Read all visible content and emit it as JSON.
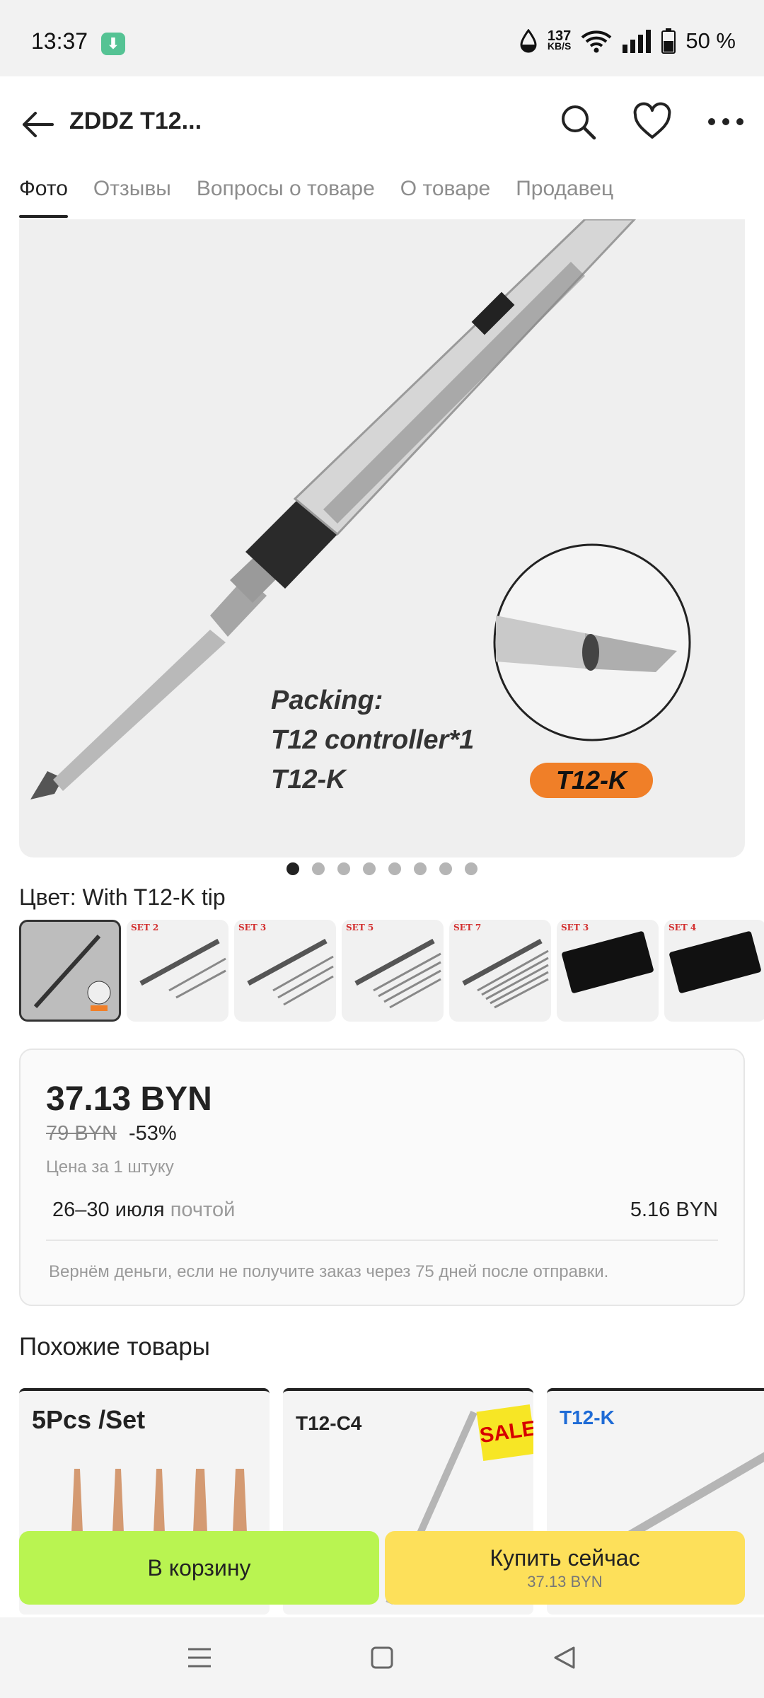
{
  "status_bar": {
    "time": "13:37",
    "speed_value": "137",
    "speed_unit": "KB/S",
    "battery": "50 %"
  },
  "header": {
    "title": "ZDDZ T12..."
  },
  "tabs": [
    {
      "label": "Фото",
      "active": true
    },
    {
      "label": "Отзывы",
      "active": false
    },
    {
      "label": "Вопросы о товаре",
      "active": false
    },
    {
      "label": "О товаре",
      "active": false
    },
    {
      "label": "Продавец",
      "active": false
    }
  ],
  "main_image": {
    "packing_lines": [
      "Packing:",
      "T12 controller*1",
      "T12-K"
    ],
    "tip_badge": "T12-K",
    "accent_color": "#f07f28"
  },
  "carousel": {
    "total": 8,
    "active_index": 0
  },
  "color_option": {
    "label": "Цвет: With T12-K tip"
  },
  "thumbnails": [
    {
      "set": ""
    },
    {
      "set": "SET 2"
    },
    {
      "set": "SET 3"
    },
    {
      "set": "SET 5"
    },
    {
      "set": "SET 7"
    },
    {
      "set": "SET 3"
    },
    {
      "set": "SET 4"
    }
  ],
  "price": {
    "current": "37.13 BYN",
    "old": "79 BYN",
    "discount": "-53%",
    "per_unit": "Цена за 1 штуку",
    "delivery_dates": "26–30 июля",
    "delivery_method": "почтой",
    "delivery_price": "5.16 BYN",
    "refund_note": "Вернём деньги, если не получите заказ через 75 дней после отправки."
  },
  "similar": {
    "title": "Похожие товары",
    "items": [
      {
        "label": "5Pcs /Set"
      },
      {
        "label": "T12-C4",
        "badge": "SALE"
      },
      {
        "label": "T12-K"
      }
    ]
  },
  "actions": {
    "cart": "В корзину",
    "buy": "Купить сейчас",
    "buy_price": "37.13 BYN",
    "cart_color": "#b9f451",
    "buy_color": "#fde05a"
  }
}
